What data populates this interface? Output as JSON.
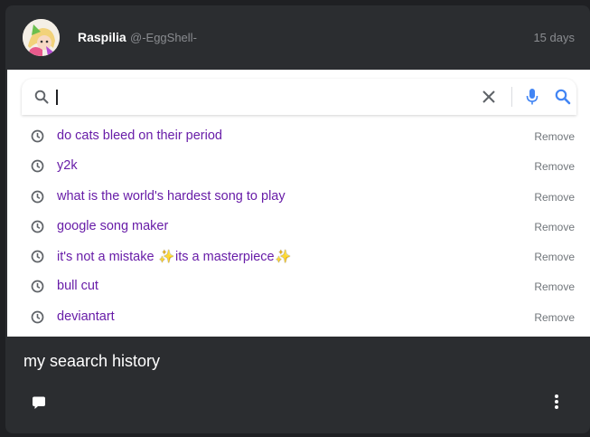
{
  "post": {
    "author_name": "Raspilia",
    "author_handle": "@-EggShell-",
    "timestamp": "15 days",
    "caption": "my seaarch history"
  },
  "search": {
    "input_value": "",
    "history": [
      {
        "query": "do cats bleed on their period",
        "remove_label": "Remove"
      },
      {
        "query": "y2k",
        "remove_label": "Remove"
      },
      {
        "query": "what is the world's hardest song to play",
        "remove_label": "Remove"
      },
      {
        "query": "google song maker",
        "remove_label": "Remove"
      },
      {
        "query_part1": "it's not a mistake ",
        "query_sparkle": "✨",
        "query_part2": "its a masterpiece",
        "query_sparkle2": "✨",
        "remove_label": "Remove"
      },
      {
        "query": "bull cut",
        "remove_label": "Remove"
      },
      {
        "query": "deviantart",
        "remove_label": "Remove"
      }
    ]
  },
  "icons": {
    "search": "search-icon",
    "clear": "close-icon",
    "mic": "microphone-icon",
    "history": "clock-icon",
    "comment": "comment-icon",
    "more": "more-vertical-icon"
  },
  "colors": {
    "card_bg": "#2b2d30",
    "page_bg": "#1f2023",
    "history_text": "#681da8",
    "remove_text": "#70757a",
    "google_blue": "#4285f4"
  }
}
